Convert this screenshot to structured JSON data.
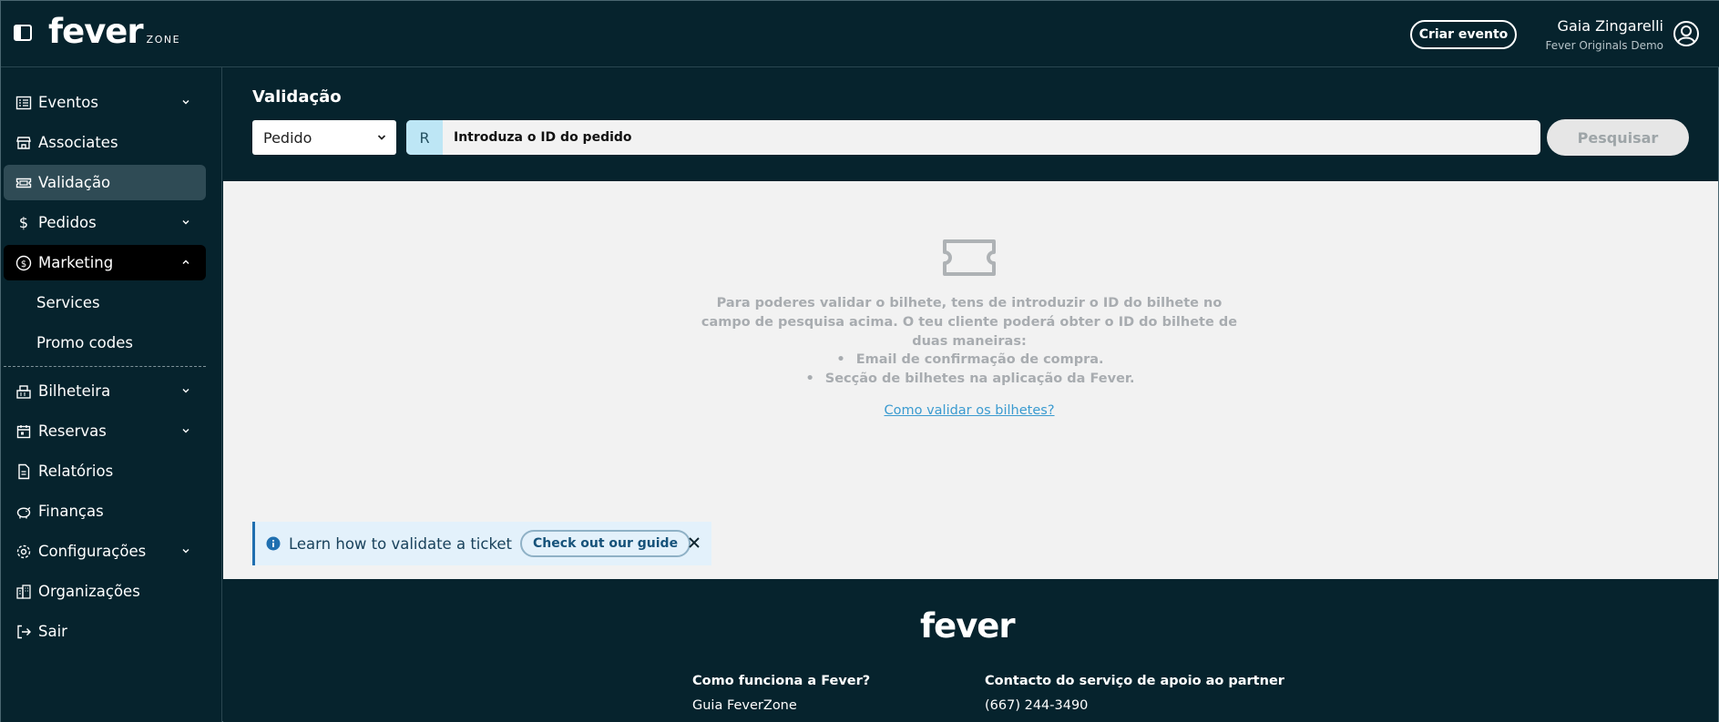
{
  "header": {
    "logo_main": "fever",
    "logo_sub": "ZONE",
    "create_button": "Criar evento",
    "user_name": "Gaia Zingarelli",
    "user_org": "Fever Originals Demo"
  },
  "sidebar": {
    "items": [
      {
        "label": "Eventos",
        "icon": "list-icon"
      },
      {
        "label": "Associates",
        "icon": "store-icon"
      },
      {
        "label": "Validação",
        "icon": "ticket-icon"
      },
      {
        "label": "Pedidos",
        "icon": "dollar-icon"
      },
      {
        "label": "Marketing",
        "icon": "coin-icon"
      },
      {
        "label": "Bilheteira",
        "icon": "register-icon"
      },
      {
        "label": "Reservas",
        "icon": "calendar-icon"
      },
      {
        "label": "Relatórios",
        "icon": "document-icon"
      },
      {
        "label": "Finanças",
        "icon": "piggy-bank-icon"
      },
      {
        "label": "Configurações",
        "icon": "gear-icon"
      },
      {
        "label": "Organizações",
        "icon": "buildings-icon"
      },
      {
        "label": "Sair",
        "icon": "logout-icon"
      }
    ],
    "marketing_sub": [
      "Services",
      "Promo codes"
    ]
  },
  "validation": {
    "title": "Validação",
    "select_value": "Pedido",
    "search_prefix": "R",
    "search_placeholder": "Introduza o ID do pedido",
    "search_button": "Pesquisar",
    "empty_text": "Para poderes validar o bilhete, tens de introduzir o ID do bilhete no campo de pesquisa acima. O teu cliente poderá obter o ID do bilhete de duas maneiras:",
    "empty_list": [
      "Email de confirmação de compra.",
      "Secção de bilhetes na aplicação da Fever."
    ],
    "guide_link": "Como validar os bilhetes?"
  },
  "banner": {
    "text": "Learn how to validate a ticket",
    "button": "Check out our guide"
  },
  "footer": {
    "logo": "fever",
    "col1_heading": "Como funciona a Fever?",
    "col1_link": "Guia FeverZone",
    "col2_heading": "Contacto do serviço de apoio ao partner",
    "col2_phone": "(667) 244-3490"
  }
}
